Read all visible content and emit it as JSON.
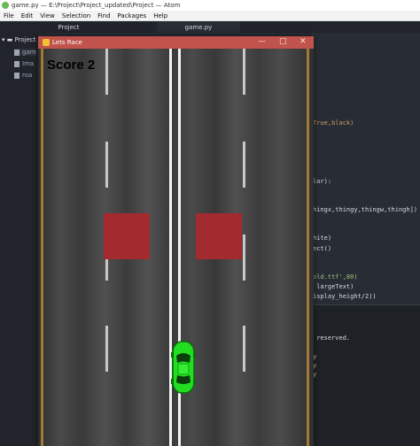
{
  "atom": {
    "window_title": "game.py — E:\\Project\\Project_updated\\Project — Atom",
    "window_controls": [
      "—",
      "□",
      "✕"
    ],
    "menu": [
      "File",
      "Edit",
      "View",
      "Selection",
      "Find",
      "Packages",
      "Help"
    ],
    "tree_header": "Project",
    "editor_tab": "game.py",
    "tree": {
      "root": "Project",
      "items": [
        "gam",
        "Ima",
        "roa"
      ]
    },
    "code_lines": [
      {
        "text": "True,black)",
        "color": "#d19a66"
      },
      {
        "text": "lor):",
        "color": "#d7dae0"
      },
      {
        "text": "hingx,thingy,thingw,thingh])",
        "color": "#d7dae0"
      },
      {
        "text": "hite)",
        "color": "#d7dae0"
      },
      {
        "text": "ect()",
        "color": "#d7dae0"
      },
      {
        "text": "old.ttf',80)",
        "color": "#98c379"
      },
      {
        "text": " largeText)",
        "color": "#d7dae0"
      },
      {
        "text": "isplay_height/2))",
        "color": "#d7dae0"
      }
    ],
    "panel_lines": [
      {
        "text": " reserved.",
        "color": "#d7dae0"
      },
      {
        "text": "y",
        "color": "#e5c07b"
      },
      {
        "text": "y",
        "color": "#e5c07b"
      },
      {
        "text": "y",
        "color": "#e5c07b"
      }
    ]
  },
  "game_window": {
    "title": "Lets Race",
    "controls": [
      "—",
      "□",
      "✕"
    ],
    "score_text": "Score 2",
    "car_color": "#22dd22",
    "obstacle_color": "#a32a2e"
  }
}
